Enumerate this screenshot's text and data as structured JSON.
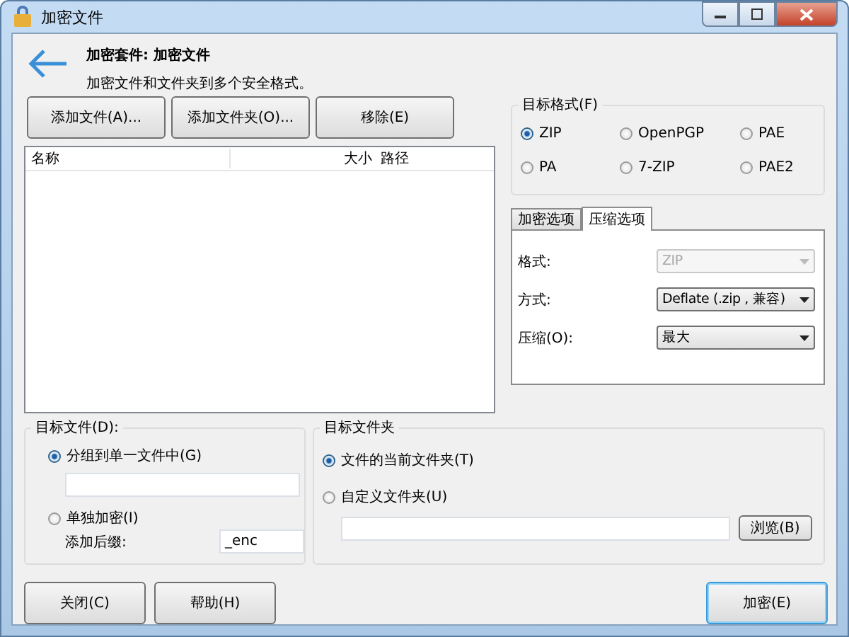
{
  "window": {
    "title": "加密文件"
  },
  "header": {
    "title": "加密套件: 加密文件",
    "subtitle": "加密文件和文件夹到多个安全格式。"
  },
  "file_buttons": [
    "添加文件(A)...",
    "添加文件夹(O)...",
    "移除(E)"
  ],
  "file_list": {
    "columns": [
      "名称",
      "大小",
      "路径"
    ]
  },
  "target_format": {
    "label": "目标格式(F)",
    "options": [
      {
        "label": "ZIP",
        "selected": true
      },
      {
        "label": "OpenPGP",
        "selected": false
      },
      {
        "label": "PAE",
        "selected": false
      },
      {
        "label": "PA",
        "selected": false
      },
      {
        "label": "7-ZIP",
        "selected": false
      },
      {
        "label": "PAE2",
        "selected": false
      }
    ]
  },
  "tabs": [
    {
      "label": "加密选项",
      "selected": false
    },
    {
      "label": "压缩选项",
      "selected": true
    }
  ],
  "compression_fields": [
    {
      "label": "格式:",
      "value": "ZIP",
      "disabled": true
    },
    {
      "label": "方式:",
      "value": "Deflate (.zip , 兼容)",
      "disabled": false
    },
    {
      "label": "压缩(O):",
      "value": "最大",
      "disabled": false
    }
  ],
  "target_file": {
    "label": "目标文件(D):",
    "options": [
      {
        "label": "分组到单一文件中(G)",
        "selected": true
      },
      {
        "label": "单独加密(I)",
        "selected": false
      }
    ],
    "suffix_label": "添加后缀:",
    "suffix_value": "_enc"
  },
  "target_folder": {
    "label": "目标文件夹",
    "options": [
      {
        "label": "文件的当前文件夹(T)",
        "selected": true
      },
      {
        "label": "自定义文件夹(U)",
        "selected": false
      }
    ],
    "browse_button": "浏览(B)"
  },
  "footer_buttons": [
    {
      "label": "关闭(C)",
      "default": false
    },
    {
      "label": "帮助(H)",
      "default": false
    },
    {
      "label": "加密(E)",
      "default": true
    }
  ]
}
